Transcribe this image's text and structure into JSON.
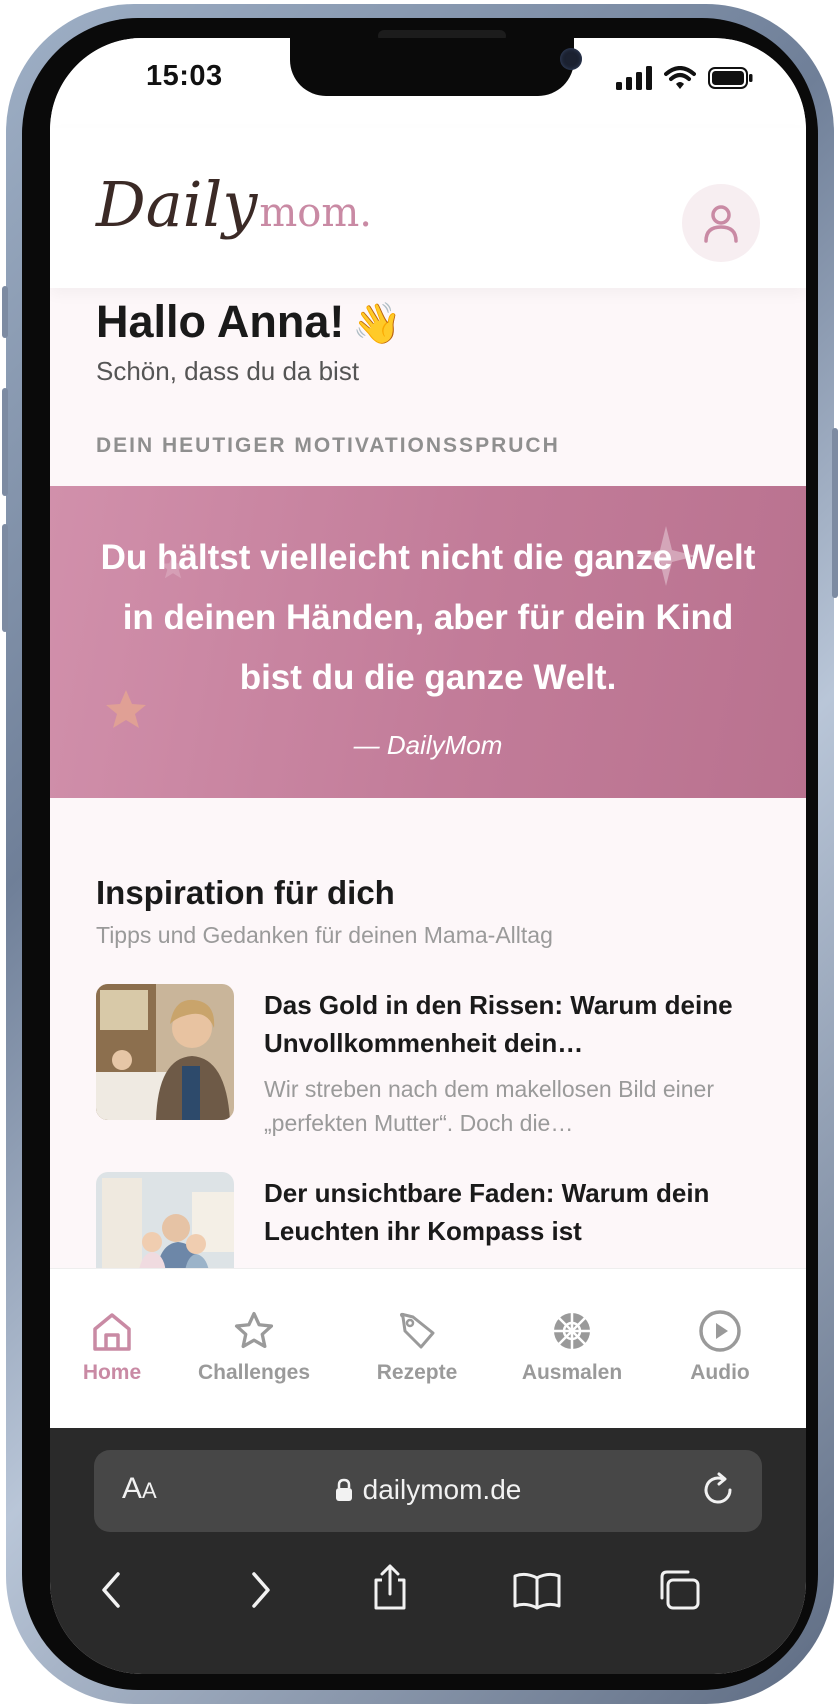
{
  "status": {
    "time": "15:03"
  },
  "header": {
    "logo_main": "Daily",
    "logo_accent": "mom."
  },
  "greeting": {
    "title": "Hallo Anna!",
    "emoji": "👋",
    "subtitle": "Schön, dass du da bist"
  },
  "motivation": {
    "label": "DEIN HEUTIGER MOTIVATIONSSPRUCH",
    "quote": "Du hältst vielleicht nicht die ganze Welt in deinen Händen, aber für dein Kind bist du die ganze Welt.",
    "author": "— DailyMom"
  },
  "inspiration": {
    "title": "Inspiration für dich",
    "subtitle": "Tipps und Gedanken für deinen Mama-Alltag",
    "articles": [
      {
        "title": "Das Gold in den Rissen: Warum deine Unvollkommenheit dein…",
        "excerpt": "Wir streben nach dem makellosen Bild einer „perfekten Mutter“. Doch die…"
      },
      {
        "title": "Der unsichtbare Faden: Warum dein Leuchten ihr Kompass ist",
        "excerpt": ""
      }
    ]
  },
  "nav": {
    "items": [
      {
        "label": "Home",
        "icon": "home-icon",
        "active": true
      },
      {
        "label": "Challenges",
        "icon": "star-icon"
      },
      {
        "label": "Rezepte",
        "icon": "tag-icon"
      },
      {
        "label": "Ausmalen",
        "icon": "coloring-icon"
      },
      {
        "label": "Audio",
        "icon": "play-icon"
      }
    ]
  },
  "browser": {
    "aa_label": "A",
    "aa_small": "A",
    "url": "dailymom.de"
  },
  "colors": {
    "accent": "#c98aa4",
    "quote_bg": "#c27c99",
    "logo_dark": "#3b2a26"
  }
}
